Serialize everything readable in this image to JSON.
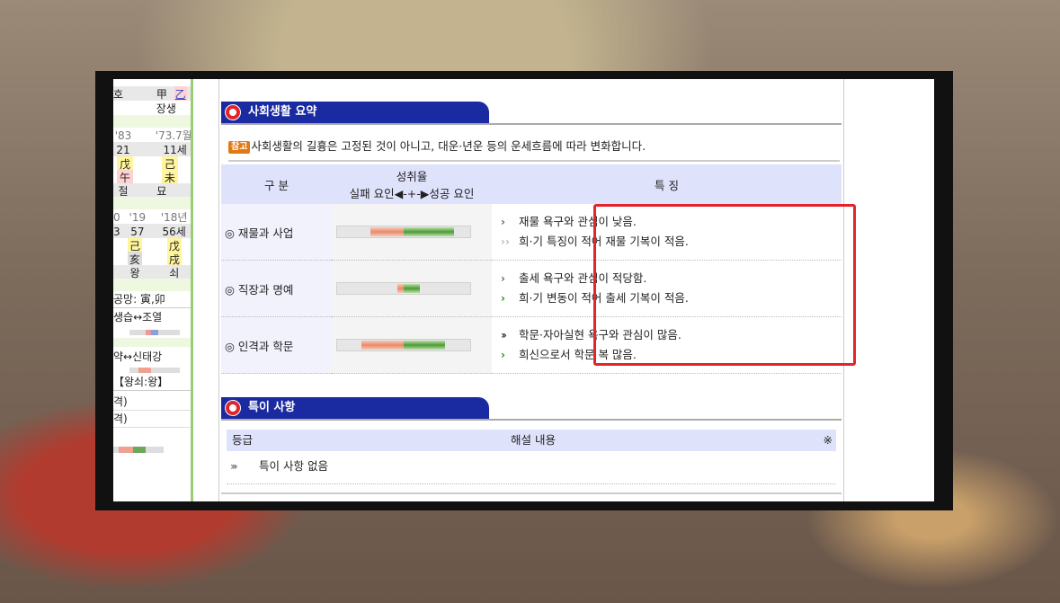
{
  "left_panel": {
    "rows": [
      {
        "cells": [
          "호",
          "甲",
          "乙"
        ]
      },
      {
        "cells": [
          "",
          "장생"
        ]
      },
      {
        "cells": [
          "'83",
          "'73.7월"
        ]
      },
      {
        "cells": [
          "21",
          "11세"
        ]
      },
      {
        "cells": [
          "戊",
          "己"
        ]
      },
      {
        "cells": [
          "午",
          "未"
        ]
      },
      {
        "cells": [
          "절",
          "묘"
        ]
      },
      {
        "cells": [
          "0",
          "'19",
          "'18년"
        ]
      },
      {
        "cells": [
          "3",
          "57",
          "56세"
        ]
      },
      {
        "cells": [
          "己",
          "戊"
        ]
      },
      {
        "cells": [
          "亥",
          "戌"
        ]
      },
      {
        "cells": [
          "왕",
          "쇠"
        ]
      },
      {
        "cells": [
          "공망: 寅,卯"
        ]
      },
      {
        "cells": [
          "생습↔조열"
        ]
      },
      {
        "cells": [
          "약↔신태강"
        ]
      },
      {
        "cells": [
          "【왕쇠:왕】"
        ]
      },
      {
        "cells": [
          "격)"
        ]
      },
      {
        "cells": [
          "격)"
        ]
      }
    ]
  },
  "social": {
    "title": "사회생활 요약",
    "notice_badge": "참고",
    "notice_text": "사회생활의 길흉은 고정된 것이 아니고, 대운·년운 등의 운세흐름에 따라 변화합니다.",
    "headers": {
      "category": "구 분",
      "rate_title": "성취율",
      "rate_sub": "실패 요인◀-+-▶성공 요인",
      "features": "특 징"
    },
    "rows": [
      {
        "category": "◎ 재물과 사업",
        "neg": 0.25,
        "pos": 0.38,
        "features": [
          {
            "arrow": "single",
            "text": "재물 욕구와 관심이 낮음."
          },
          {
            "arrow": "faded",
            "text": "희·기 특징이 적어 재물 기복이 적음."
          }
        ]
      },
      {
        "category": "◎ 직장과 명예",
        "neg": 0.05,
        "pos": 0.12,
        "features": [
          {
            "arrow": "single",
            "text": "출세 욕구와 관심이 적당함."
          },
          {
            "arrow": "green",
            "text": "희·기 변동이 적어 출세 기복이 적음."
          }
        ]
      },
      {
        "category": "◎ 인격과 학문",
        "neg": 0.32,
        "pos": 0.31,
        "features": [
          {
            "arrow": "double",
            "text": "학문·자아실현 욕구와 관심이 많음."
          },
          {
            "arrow": "green",
            "text": "희신으로서 학문 복 많음."
          }
        ]
      }
    ]
  },
  "special": {
    "title": "특이 사항",
    "col_grade": "등급",
    "col_desc": "해설 내용",
    "col_mark": "※",
    "row_text": "특이 사항 없음"
  },
  "colors": {
    "tab_blue": "#1a2aa0",
    "highlight_red": "#e3242b",
    "header_lavender": "#dfe2fb"
  }
}
